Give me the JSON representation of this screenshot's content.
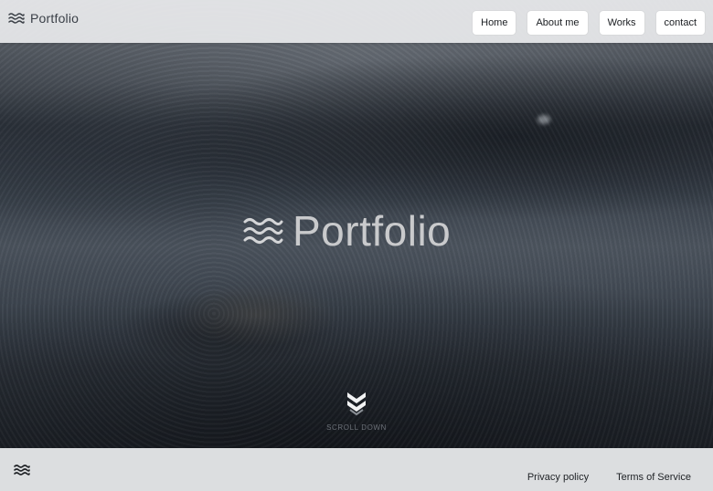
{
  "header": {
    "brand": "Portfolio",
    "nav": [
      "Home",
      "About me",
      "Works",
      "contact"
    ]
  },
  "hero": {
    "title": "Portfolio",
    "scroll_label": "SCROLL DOWN"
  },
  "footer": {
    "links": [
      "Privacy policy",
      "Terms of Service"
    ]
  },
  "icons": {
    "brand": "waves-icon",
    "hero": "waves-icon",
    "scroll": "double-chevron-down-icon",
    "footer": "waves-icon"
  },
  "colors": {
    "header_bg": "#e8eaec",
    "button_bg": "#ffffff",
    "hero_text": "#c9cacc",
    "footer_bg": "#dcdee0"
  }
}
